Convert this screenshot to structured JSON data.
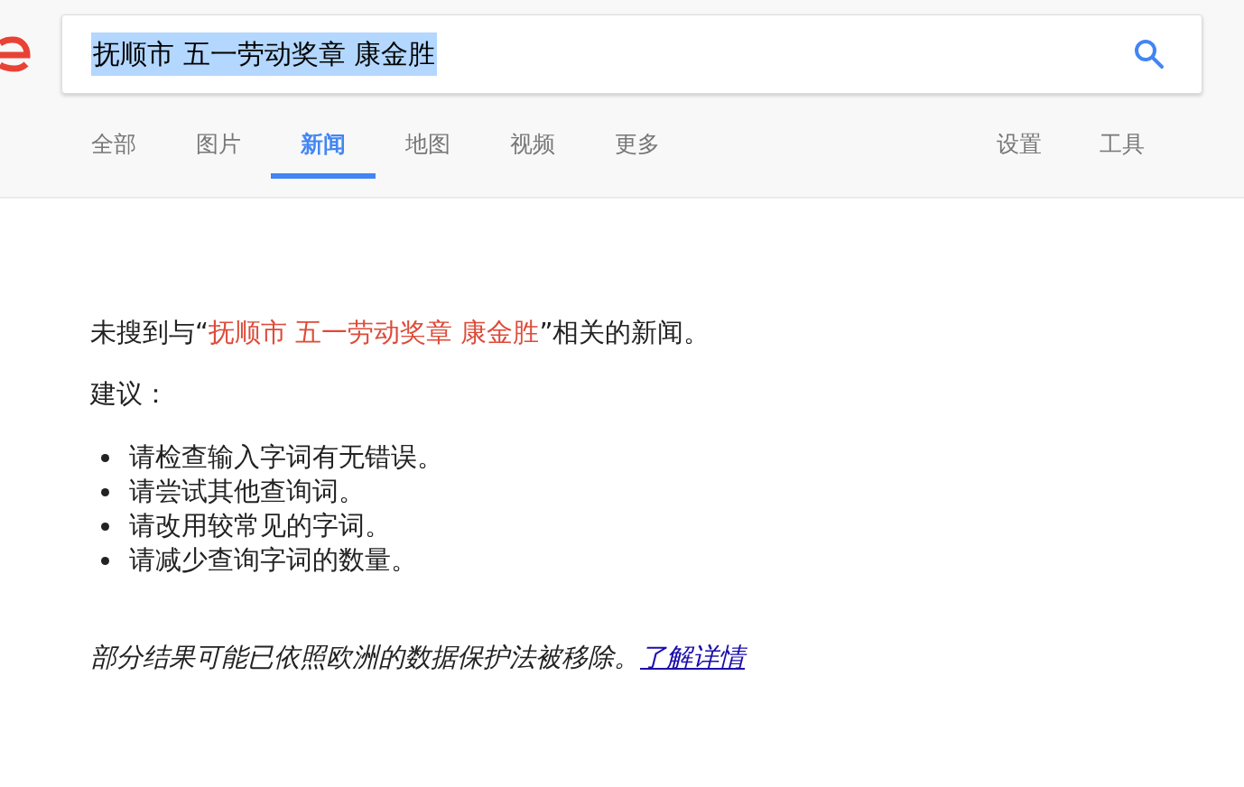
{
  "search": {
    "value": "抚顺市 五一劳动奖章 康金胜",
    "text_selected": true
  },
  "tabs": [
    {
      "label": "全部",
      "selected": false
    },
    {
      "label": "图片",
      "selected": false
    },
    {
      "label": "新闻",
      "selected": true
    },
    {
      "label": "地图",
      "selected": false
    },
    {
      "label": "视频",
      "selected": false
    },
    {
      "label": "更多",
      "selected": false
    }
  ],
  "tools": [
    {
      "label": "设置"
    },
    {
      "label": "工具"
    }
  ],
  "no_results": {
    "prefix": "未搜到与“",
    "query": "抚顺市 五一劳动奖章 康金胜",
    "suffix": "”相关的新闻。"
  },
  "suggestions_title": "建议：",
  "suggestions": [
    "请检查输入字词有无错误。",
    "请尝试其他查询词。",
    "请改用较常见的字词。",
    "请减少查询字词的数量。"
  ],
  "notice": {
    "text": "部分结果可能已依照欧洲的数据保护法被移除。",
    "link": "了解详情"
  }
}
